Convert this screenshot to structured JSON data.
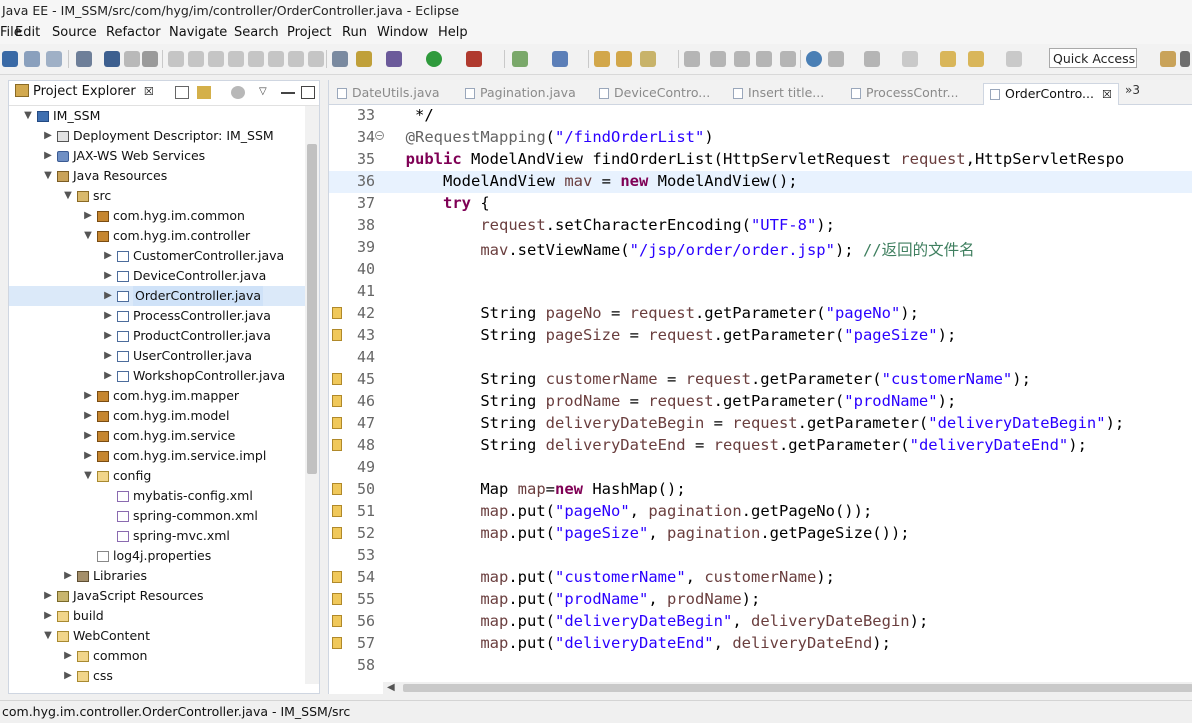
{
  "window": {
    "title": "Java EE - IM_SSM/src/com/hyg/im/controller/OrderController.java - Eclipse"
  },
  "menu": [
    "File",
    "Edit",
    "Source",
    "Refactor",
    "Navigate",
    "Search",
    "Project",
    "Run",
    "Window",
    "Help"
  ],
  "toolbar": {
    "quick_access_label": "Quick Access"
  },
  "explorer": {
    "tab_label": "Project Explorer",
    "tab_close": "☒",
    "tree": [
      {
        "label": "IM_SSM",
        "icon": "project-icon",
        "expanded": true,
        "selected": false
      },
      {
        "label": "Deployment Descriptor: IM_SSM",
        "icon": "descriptor-icon",
        "expanded": false,
        "selected": false
      },
      {
        "label": "JAX-WS Web Services",
        "icon": "web-services-icon",
        "expanded": false,
        "selected": false
      },
      {
        "label": "Java Resources",
        "icon": "java-resources-icon",
        "expanded": true,
        "selected": false
      },
      {
        "label": "src",
        "icon": "source-folder-icon",
        "expanded": true,
        "selected": false
      },
      {
        "label": "com.hyg.im.common",
        "icon": "package-icon",
        "expanded": false,
        "selected": false
      },
      {
        "label": "com.hyg.im.controller",
        "icon": "package-icon",
        "expanded": true,
        "selected": false
      },
      {
        "label": "CustomerController.java",
        "icon": "java-file-icon",
        "expanded": false,
        "selected": false
      },
      {
        "label": "DeviceController.java",
        "icon": "java-file-icon",
        "expanded": false,
        "selected": false
      },
      {
        "label": "OrderController.java",
        "icon": "java-file-icon",
        "expanded": false,
        "selected": true
      },
      {
        "label": "ProcessController.java",
        "icon": "java-file-icon",
        "expanded": false,
        "selected": false
      },
      {
        "label": "ProductController.java",
        "icon": "java-file-icon",
        "expanded": false,
        "selected": false
      },
      {
        "label": "UserController.java",
        "icon": "java-file-icon",
        "expanded": false,
        "selected": false
      },
      {
        "label": "WorkshopController.java",
        "icon": "java-file-icon",
        "expanded": false,
        "selected": false
      },
      {
        "label": "com.hyg.im.mapper",
        "icon": "package-icon",
        "expanded": false,
        "selected": false
      },
      {
        "label": "com.hyg.im.model",
        "icon": "package-icon",
        "expanded": false,
        "selected": false
      },
      {
        "label": "com.hyg.im.service",
        "icon": "package-icon",
        "expanded": false,
        "selected": false
      },
      {
        "label": "com.hyg.im.service.impl",
        "icon": "package-icon",
        "expanded": false,
        "selected": false
      },
      {
        "label": "config",
        "icon": "config-folder-icon",
        "expanded": true,
        "selected": false
      },
      {
        "label": "mybatis-config.xml",
        "icon": "xml-file-icon",
        "expanded": false,
        "selected": false
      },
      {
        "label": "spring-common.xml",
        "icon": "xml-file-icon",
        "expanded": false,
        "selected": false
      },
      {
        "label": "spring-mvc.xml",
        "icon": "xml-file-icon",
        "expanded": false,
        "selected": false
      },
      {
        "label": "log4j.properties",
        "icon": "properties-file-icon",
        "expanded": false,
        "selected": false
      },
      {
        "label": "Libraries",
        "icon": "libraries-icon",
        "expanded": false,
        "selected": false
      },
      {
        "label": "JavaScript Resources",
        "icon": "javascript-resources-icon",
        "expanded": false,
        "selected": false
      },
      {
        "label": "build",
        "icon": "folder-icon",
        "expanded": false,
        "selected": false
      },
      {
        "label": "WebContent",
        "icon": "folder-icon",
        "expanded": true,
        "selected": false
      },
      {
        "label": "common",
        "icon": "folder-icon",
        "expanded": false,
        "selected": false
      },
      {
        "label": "css",
        "icon": "folder-icon",
        "expanded": false,
        "selected": false
      }
    ]
  },
  "editor": {
    "tabs": [
      {
        "label": "DateUtils.java",
        "active": false
      },
      {
        "label": "Pagination.java",
        "active": false
      },
      {
        "label": "DeviceContro...",
        "active": false
      },
      {
        "label": "Insert title...",
        "active": false
      },
      {
        "label": "ProcessContr...",
        "active": false
      },
      {
        "label": "OrderContro...",
        "active": true
      }
    ],
    "active_tab_close": "☒",
    "overflow_label": "»3",
    "lines": [
      {
        "num": "33",
        "text": "   */"
      },
      {
        "num": "34",
        "text": "  @RequestMapping(\"/findOrderList\")"
      },
      {
        "num": "35",
        "text": "  public ModelAndView findOrderList(HttpServletRequest request,HttpServletRespo"
      },
      {
        "num": "36",
        "text": "      ModelAndView mav = new ModelAndView();"
      },
      {
        "num": "37",
        "text": "      try {"
      },
      {
        "num": "38",
        "text": "          request.setCharacterEncoding(\"UTF-8\");"
      },
      {
        "num": "39",
        "text": "          mav.setViewName(\"/jsp/order/order.jsp\"); //返回的文件名"
      },
      {
        "num": "40",
        "text": ""
      },
      {
        "num": "41",
        "text": ""
      },
      {
        "num": "42",
        "text": "          String pageNo = request.getParameter(\"pageNo\");"
      },
      {
        "num": "43",
        "text": "          String pageSize = request.getParameter(\"pageSize\");"
      },
      {
        "num": "44",
        "text": ""
      },
      {
        "num": "45",
        "text": "          String customerName = request.getParameter(\"customerName\");"
      },
      {
        "num": "46",
        "text": "          String prodName = request.getParameter(\"prodName\");"
      },
      {
        "num": "47",
        "text": "          String deliveryDateBegin = request.getParameter(\"deliveryDateBegin\");"
      },
      {
        "num": "48",
        "text": "          String deliveryDateEnd = request.getParameter(\"deliveryDateEnd\");"
      },
      {
        "num": "49",
        "text": ""
      },
      {
        "num": "50",
        "text": "          Map map=new HashMap();"
      },
      {
        "num": "51",
        "text": "          map.put(\"pageNo\", pagination.getPageNo());"
      },
      {
        "num": "52",
        "text": "          map.put(\"pageSize\", pagination.getPageSize());"
      },
      {
        "num": "53",
        "text": ""
      },
      {
        "num": "54",
        "text": "          map.put(\"customerName\", customerName);"
      },
      {
        "num": "55",
        "text": "          map.put(\"prodName\", prodName);"
      },
      {
        "num": "56",
        "text": "          map.put(\"deliveryDateBegin\", deliveryDateBegin);"
      },
      {
        "num": "57",
        "text": "          map.put(\"deliveryDateEnd\", deliveryDateEnd);"
      },
      {
        "num": "58",
        "text": ""
      }
    ],
    "current_line": "36",
    "warning_lines": [
      "42",
      "43",
      "45",
      "46",
      "47",
      "48",
      "50",
      "51",
      "52",
      "54",
      "55",
      "56",
      "57"
    ],
    "fold_line": "34"
  },
  "status": {
    "text": "com.hyg.im.controller.OrderController.java - IM_SSM/src"
  },
  "colors": {
    "keyword": "#7f0055",
    "string": "#2a00ff",
    "annotation": "#646464",
    "comment": "#3f7f5f",
    "local_variable": "#6a3e3e",
    "field": "#0000c0",
    "current_line_bg": "#e8f2fe",
    "selection_bg": "#dbe9f9"
  }
}
